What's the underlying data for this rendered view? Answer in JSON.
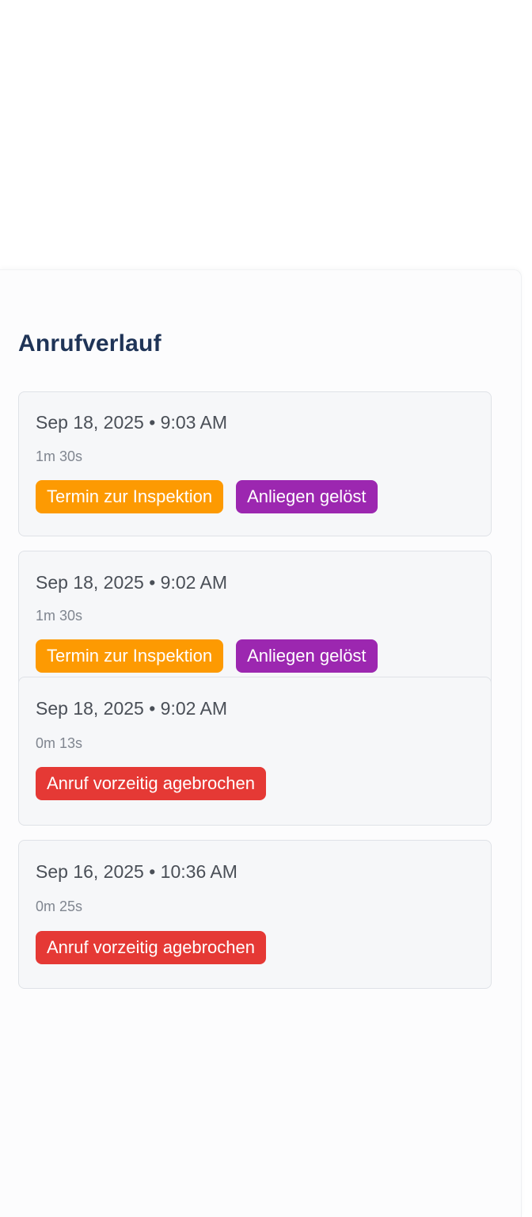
{
  "colors": {
    "title": "#1f3457",
    "orange": "#fd9a02",
    "purple": "#9c27b0",
    "red": "#e53935"
  },
  "history": {
    "title": "Anrufverlauf",
    "calls": [
      {
        "datetime": "Sep 18, 2025 • 9:03 AM",
        "duration": "1m 30s",
        "tags": [
          {
            "label": "Termin zur Inspektion",
            "color": "#fd9a02"
          },
          {
            "label": "Anliegen gelöst",
            "color": "#9c27b0"
          }
        ]
      },
      {
        "datetime": "Sep 18, 2025 • 9:02 AM",
        "duration": "1m 30s",
        "tags": [
          {
            "label": "Termin zur Inspektion",
            "color": "#fd9a02"
          },
          {
            "label": "Anliegen gelöst",
            "color": "#9c27b0"
          }
        ]
      },
      {
        "datetime": "Sep 18, 2025 • 9:02 AM",
        "duration": "0m 13s",
        "tags": [
          {
            "label": "Anruf vorzeitig agebrochen",
            "color": "#e53935"
          }
        ]
      },
      {
        "datetime": "Sep 16, 2025 • 10:36 AM",
        "duration": "0m 25s",
        "tags": [
          {
            "label": "Anruf vorzeitig agebrochen",
            "color": "#e53935"
          }
        ]
      }
    ]
  }
}
